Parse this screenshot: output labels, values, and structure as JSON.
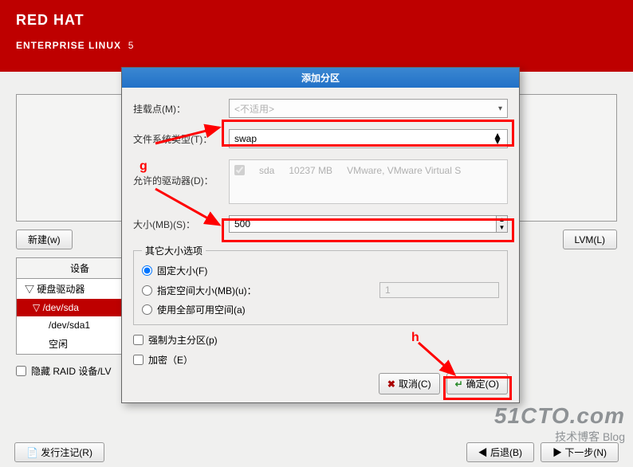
{
  "banner": {
    "line1": "RED HAT",
    "line2": "ENTERPRISE LINUX",
    "ver": "5"
  },
  "dialog": {
    "title": "添加分区",
    "mount": {
      "label": "挂载点(M)：",
      "value": "<不适用>"
    },
    "fstype": {
      "label": "文件系统类型(T)：",
      "value": "swap"
    },
    "drives": {
      "label": "允许的驱动器(D)：",
      "disk": "sda",
      "size": "10237 MB",
      "vendor": "VMware, VMware Virtual S"
    },
    "size": {
      "label": "大小(MB)(S)：",
      "value": "500"
    },
    "other_size_legend": "其它大小选项",
    "radios": {
      "fixed": "固定大小(F)",
      "upto": "指定空间大小(MB)(u)：",
      "upto_val": "1",
      "fill": "使用全部可用空间(a)"
    },
    "force_primary": "强制为主分区(p)",
    "encrypt": "加密（E）",
    "cancel": "取消(C)",
    "ok": "确定(O)"
  },
  "annot": {
    "g": "g",
    "h": "h"
  },
  "main": {
    "new_btn": "新建(w)",
    "lvm_btn": "LVM(L)",
    "device_col": "设备",
    "tree": {
      "root": "硬盘驱动器",
      "dev": "/dev/sda",
      "part": "/dev/sda1",
      "free": "空闲"
    },
    "hide_raid": "隐藏 RAID 设备/LV",
    "release_notes": "发行注记(R)",
    "back": "后退(B)",
    "next": "下一步(N)"
  },
  "watermark": {
    "big": "51CTO.com",
    "sm": "技术博客  Blog"
  }
}
